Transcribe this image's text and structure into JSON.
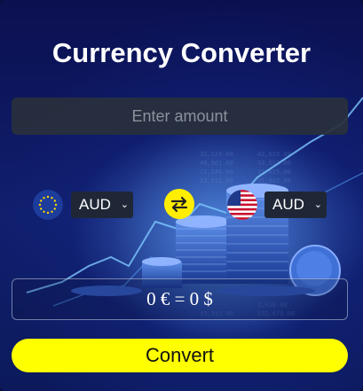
{
  "app": {
    "title": "Currency Converter"
  },
  "amount_input": {
    "placeholder": "Enter amount",
    "value": ""
  },
  "from": {
    "flag_icon": "eu-flag-icon",
    "currency": "AUD"
  },
  "to": {
    "flag_icon": "us-flag-icon",
    "currency": "AUD"
  },
  "swap": {
    "icon": "swap-arrows-icon"
  },
  "result": {
    "text": "0 € = 0 $"
  },
  "convert": {
    "label": "Convert"
  },
  "colors": {
    "accent": "#ffff00",
    "background": "#0b1050",
    "select_bg": "#1f2737"
  }
}
